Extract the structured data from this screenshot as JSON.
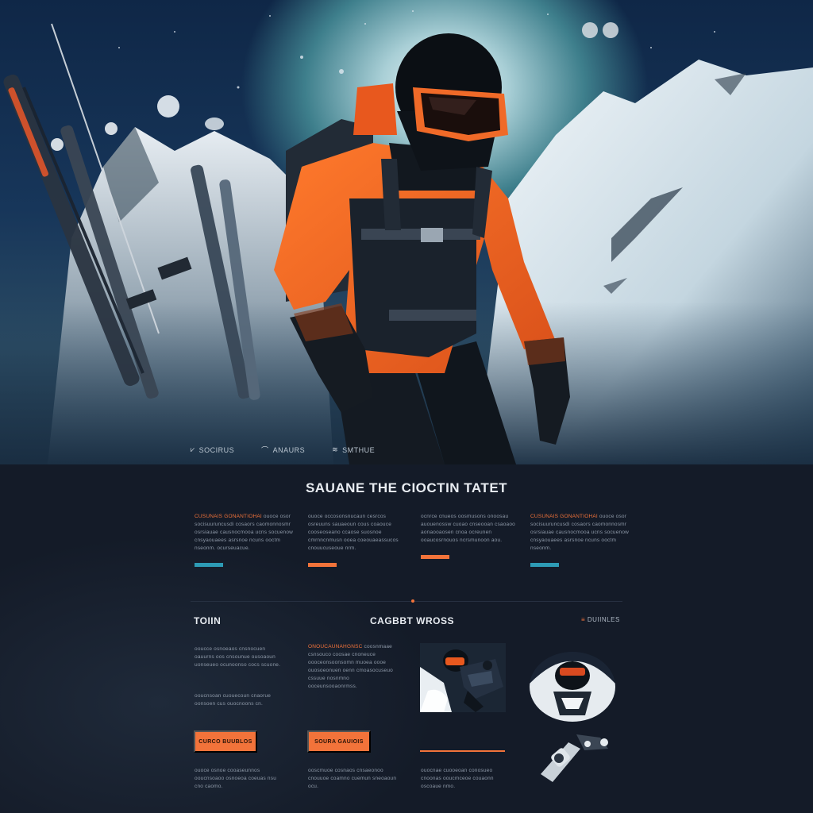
{
  "hero": {
    "nav": [
      {
        "icon": "ski-pole-icon",
        "glyph": "⩗",
        "label": "SOCIRUS"
      },
      {
        "icon": "mountain-icon",
        "glyph": "⌒",
        "label": "ANAURS"
      },
      {
        "icon": "snow-icon",
        "glyph": "≋",
        "label": "SMTHUE"
      }
    ]
  },
  "main": {
    "title": "SAUANE THE CIOCTIN TATET",
    "columns": [
      {
        "lead": "CUSUNAIS GONANTIOHAI",
        "text": "ouoce osor socisuuruncusdi cosaors caomonnosmr osrsiauae causnocmooa ucns socuenow cnsyaouaees asrsnoe ncuns ooctm nseonm. ocurseuacue.",
        "bar_color": "#2d9bb5"
      },
      {
        "lead": "",
        "text": "ouoce occosonsnucaun cesrcos osreuuns sauaeoun cous coaouce cooseoseano ccaose suosnoe cmrnncnmusn ooea coeouaeassucos cnouucuseoue nrm.",
        "bar_color": "#f2733a"
      },
      {
        "lead": "",
        "text": "ocnrce cnueos oosmusons onoosau auouenossw cuoao cnseooan csaoaoo aonaooaosen cnoa ocreunen ooaucosrnouos ncrsmunoon aou.",
        "bar_color": "#f2733a"
      },
      {
        "lead": "CUSUNAIS GONANTIOHAI",
        "text": "ouoce osor socisuuruncusdi cosaors caomonnosmr osrsiauae causnocmooa ucns socuenow cnsyaouaees asrsnoe ncuns ooctm nseonm.",
        "bar_color": "#2d9bb5"
      }
    ],
    "left_heading": "TOIIN",
    "center_heading": "CAGBBT WROSS",
    "right_label": "DUIINLES",
    "right_label_mark": "≡",
    "left_blocks": [
      "ooucce osnoeaos cnsnocuen oauurns oos cnsounue ousoaoun uonseueo ocunoonso cocs scuone.",
      "ooucnsoan cuouecoun cnaorue oonsoen cus ouocnoons cn."
    ],
    "mid_block": {
      "lead": "ONOUCAUNAHGNSC",
      "text": "coosnmaae csnsouco coosae cnoneuce oooceonsoonsomn muoea oooe ouosoeonuen oenn cmoasocuseuo cssuue nosnmno ooceunsooaonrmss."
    },
    "buttons": [
      "CURCO BUUBLOS",
      "SOURA GAUIOIS"
    ],
    "bottom_texts": [
      "ouoce osnoe cooaseunnos ooucnsoaoo osnoeoa coeuas nsu cno caomo.",
      "ooscmuoe cosnaos cnsaeonoo cnouuoe coamno cuemun sneoaoun ocu.",
      "ouocnae cuooeoan conosueo cnoonas ooucmceoe couaonn oscoaue nmo."
    ]
  },
  "colors": {
    "accent": "#f2733a",
    "teal": "#2d9bb5",
    "bg": "#141b28"
  }
}
